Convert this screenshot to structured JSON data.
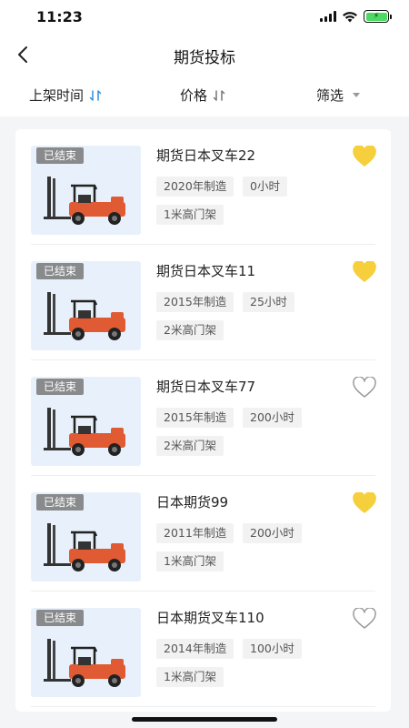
{
  "status_bar": {
    "time": "11:23"
  },
  "nav": {
    "title": "期货投标"
  },
  "filters": {
    "time_label": "上架时间",
    "price_label": "价格",
    "filter_label": "筛选"
  },
  "colors": {
    "accent": "#2f8ee0",
    "heart_filled": "#f5cf3c",
    "heart_outline": "#9a9a9a",
    "forklift_body": "#e05a34"
  },
  "items": [
    {
      "badge": "已结束",
      "title": "期货日本叉车22",
      "year_tag": "2020年制造",
      "hours_tag": "0小时",
      "mast_tag": "1米高门架",
      "favorited": true
    },
    {
      "badge": "已结束",
      "title": "期货日本叉车11",
      "year_tag": "2015年制造",
      "hours_tag": "25小时",
      "mast_tag": "2米高门架",
      "favorited": true
    },
    {
      "badge": "已结束",
      "title": "期货日本叉车77",
      "year_tag": "2015年制造",
      "hours_tag": "200小时",
      "mast_tag": "2米高门架",
      "favorited": false
    },
    {
      "badge": "已结束",
      "title": "日本期货99",
      "year_tag": "2011年制造",
      "hours_tag": "200小时",
      "mast_tag": "1米高门架",
      "favorited": true
    },
    {
      "badge": "已结束",
      "title": "日本期货叉车110",
      "year_tag": "2014年制造",
      "hours_tag": "100小时",
      "mast_tag": "1米高门架",
      "favorited": false
    }
  ]
}
